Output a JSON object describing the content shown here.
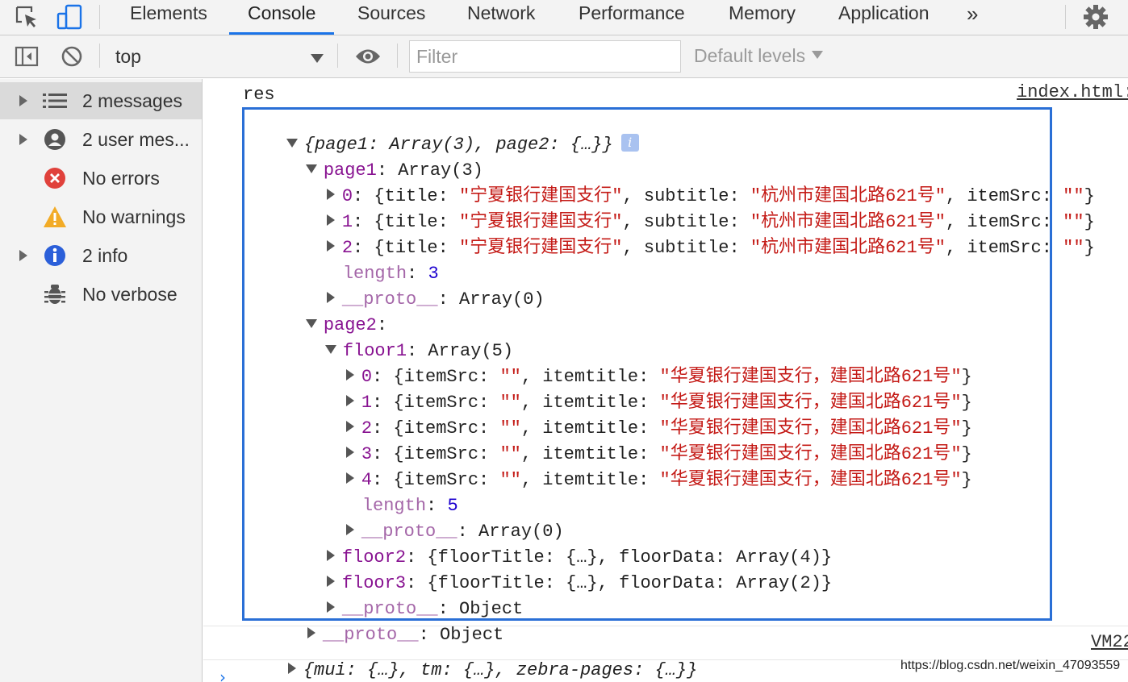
{
  "tabs": {
    "elements": "Elements",
    "console": "Console",
    "sources": "Sources",
    "network": "Network",
    "performance": "Performance",
    "memory": "Memory",
    "application": "Application",
    "more": "»"
  },
  "toolbar": {
    "context": "top",
    "filter_placeholder": "Filter",
    "levels": "Default levels"
  },
  "sidebar": {
    "items": [
      {
        "label": "2 messages",
        "icon": "list-icon"
      },
      {
        "label": "2 user mes...",
        "icon": "user-icon"
      },
      {
        "label": "No errors",
        "icon": "error-icon"
      },
      {
        "label": "No warnings",
        "icon": "warning-icon"
      },
      {
        "label": "2 info",
        "icon": "info-icon"
      },
      {
        "label": "No verbose",
        "icon": "bug-icon"
      }
    ]
  },
  "console": {
    "res_label": "res",
    "source1": "index.html:",
    "source2": "VM22",
    "summary": "{page1: Array(3), page2: {…}}",
    "page1_key": "page1",
    "page1_val": ": Array(3)",
    "page1_items": [
      {
        "idx": "0",
        "title": "宁夏银行建国支行",
        "subtitle": "杭州市建国北路621号",
        "itemSrc": "\"\""
      },
      {
        "idx": "1",
        "title": "宁夏银行建国支行",
        "subtitle": "杭州市建国北路621号",
        "itemSrc": "\"\""
      },
      {
        "idx": "2",
        "title": "宁夏银行建国支行",
        "subtitle": "杭州市建国北路621号",
        "itemSrc": "\"\""
      }
    ],
    "length_key": "length",
    "page1_length": "3",
    "proto_key": "__proto__",
    "array0": ": Array(0)",
    "page2_key": "page2",
    "floor1_key": "floor1",
    "floor1_val": ": Array(5)",
    "floor1_items": [
      {
        "idx": "0",
        "itemtitle": "华夏银行建国支行，建国北路621号"
      },
      {
        "idx": "1",
        "itemtitle": "华夏银行建国支行，建国北路621号"
      },
      {
        "idx": "2",
        "itemtitle": "华夏银行建国支行，建国北路621号"
      },
      {
        "idx": "3",
        "itemtitle": "华夏银行建国支行，建国北路621号"
      },
      {
        "idx": "4",
        "itemtitle": "华夏银行建国支行，建国北路621号"
      }
    ],
    "floor1_length": "5",
    "floor2_key": "floor2",
    "floor2_val": ": {floorTitle: {…}, floorData: Array(4)}",
    "floor3_key": "floor3",
    "floor3_val": ": {floorTitle: {…}, floorData: Array(2)}",
    "object_val": ": Object",
    "second_log": "{mui: {…}, tm: {…}, zebra-pages: {…}}",
    "prompt": "›"
  },
  "watermark": "https://blog.csdn.net/weixin_47093559",
  "colors": {
    "highlight_border": "#2a6fd6",
    "key_purple": "#881391",
    "string_red": "#c41a16",
    "number_blue": "#1c00cf",
    "active_tab": "#1a73e8"
  }
}
